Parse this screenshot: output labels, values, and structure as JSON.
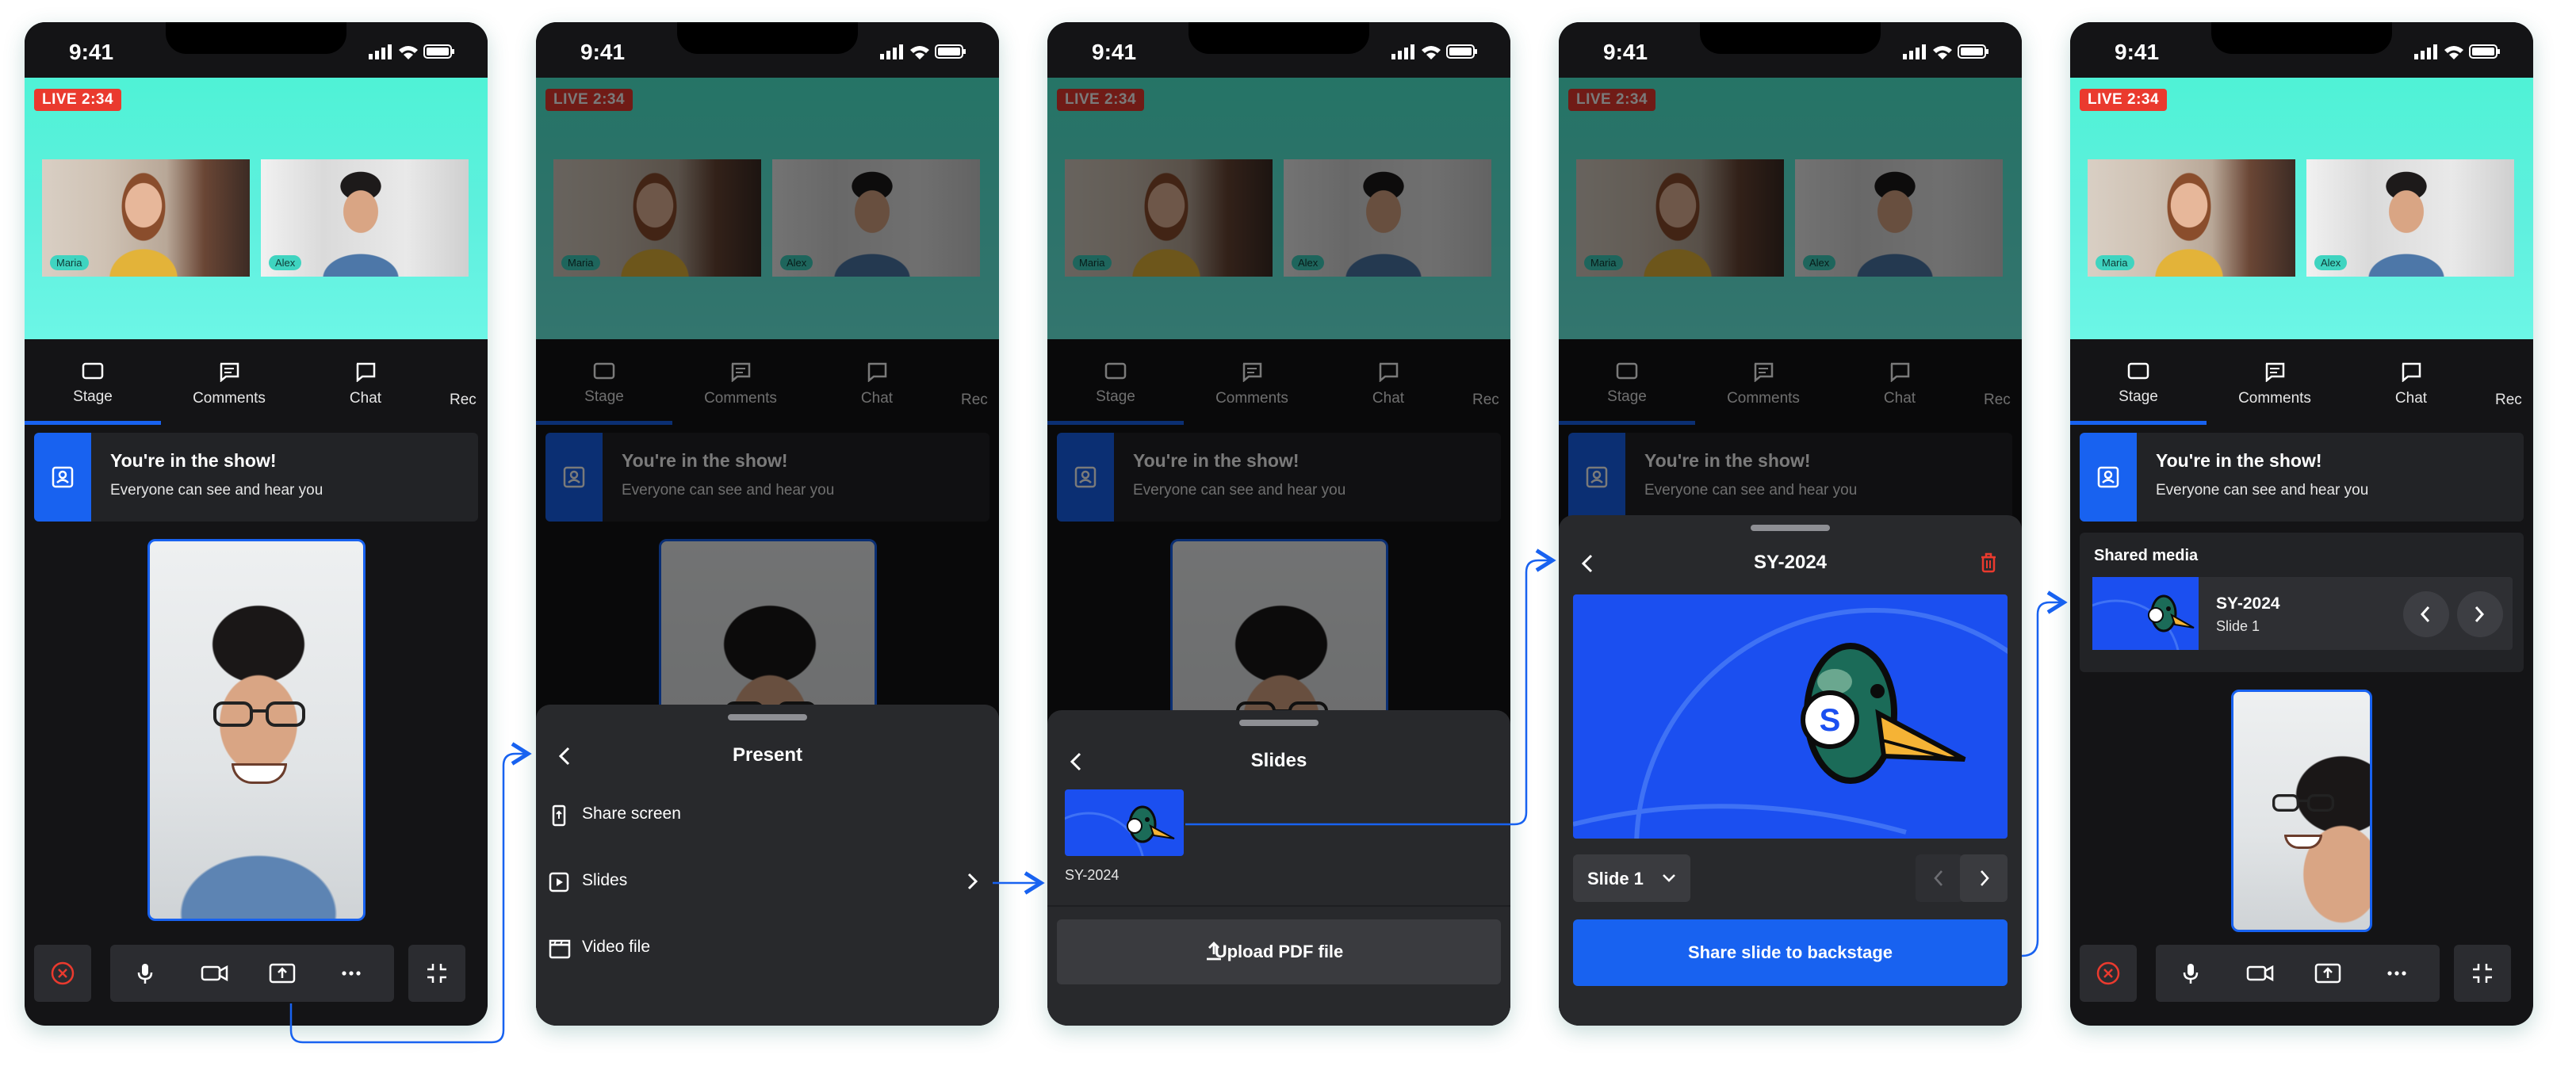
{
  "colors": {
    "accent": "#1862f0",
    "live": "#ea3a2e",
    "stage_bg": "#5ff0de",
    "panel_bg": "#222326",
    "phone_bg": "#141416",
    "danger": "#ea3a2e"
  },
  "status": {
    "time": "9:41"
  },
  "stage": {
    "live_label": "LIVE 2:34",
    "participants": [
      {
        "name": "Maria"
      },
      {
        "name": "Alex"
      }
    ]
  },
  "tabs": [
    {
      "label": "Stage",
      "icon": "square-icon",
      "active": true
    },
    {
      "label": "Comments",
      "icon": "comment-box-icon"
    },
    {
      "label": "Chat",
      "icon": "chat-bubble-icon"
    },
    {
      "label": "Rec",
      "icon": ""
    }
  ],
  "banner": {
    "title": "You're in the show!",
    "subtitle": "Everyone can see and hear you",
    "icon": "person-badge-icon"
  },
  "controls": [
    {
      "name": "leave",
      "icon": "close-circle-icon"
    },
    {
      "name": "microphone",
      "icon": "mic-icon"
    },
    {
      "name": "camera",
      "icon": "video-camera-icon"
    },
    {
      "name": "present",
      "icon": "screen-share-icon"
    },
    {
      "name": "more",
      "icon": "more-dots-icon"
    },
    {
      "name": "minimize",
      "icon": "collapse-icon"
    }
  ],
  "present_sheet": {
    "title": "Present",
    "items": [
      {
        "label": "Share screen",
        "icon": "phone-share-icon"
      },
      {
        "label": "Slides",
        "icon": "play-box-icon",
        "has_chevron": true
      },
      {
        "label": "Video file",
        "icon": "clapperboard-icon"
      }
    ]
  },
  "slides_sheet": {
    "title": "Slides",
    "files": [
      {
        "name": "SY-2024"
      }
    ],
    "upload_label": "Upload PDF file"
  },
  "slide_preview": {
    "title": "SY-2024",
    "current_slide": "Slide 1",
    "share_label": "Share slide to backstage"
  },
  "shared_media": {
    "heading": "Shared media",
    "item_name": "SY-2024",
    "item_slide": "Slide 1"
  }
}
